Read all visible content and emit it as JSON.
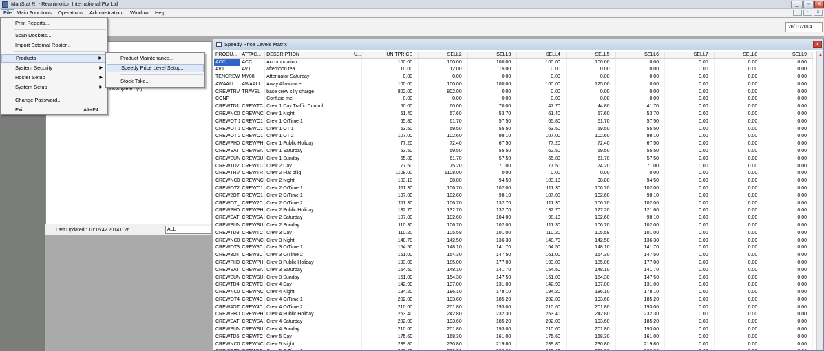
{
  "app": {
    "title": "ManStat RI - Reanimotion International Pty Ltd",
    "window_buttons": {
      "minimize": "_",
      "restore": "▫",
      "close": "✕"
    },
    "mdi_buttons": {
      "minimize": "_",
      "restore": "▫",
      "close": "x"
    }
  },
  "menubar": {
    "items": [
      "File",
      "Main Functions",
      "Operations",
      "Administration",
      "Window",
      "Help"
    ]
  },
  "toolbar": {
    "date": "26/11/2014"
  },
  "file_menu": {
    "items": [
      {
        "label": "Print Reports..."
      },
      {
        "label": "Scan Dockets..."
      },
      {
        "label": "Import External Roster..."
      },
      {
        "label": "Products",
        "arrow": "▶"
      },
      {
        "label": "System Security",
        "arrow": "▶"
      },
      {
        "label": "Roster Setup",
        "arrow": "▶"
      },
      {
        "label": "System Setup",
        "arrow": "▶"
      },
      {
        "label": "Change Password..."
      },
      {
        "label": "Exit",
        "accel": "Alt+F4"
      }
    ]
  },
  "products_submenu": {
    "items": [
      "Product Maintenance...",
      "Speedy Price Level Setup...",
      "Stock Take..."
    ]
  },
  "left_panel": {
    "incomplete_label": "Incomplete",
    "incomplete_count": "(4)",
    "last_updated": "Last Updated : 10:16:42 20141126",
    "filter_value": "ALL"
  },
  "grid_window": {
    "title": "Speedy Price Levels Matrix",
    "close": "x",
    "columns": [
      "PRODU...",
      "ATTAC...",
      "DESCRIPTION",
      "U...",
      "UNITPRICE",
      "SELL2",
      "SELL3",
      "SELL4",
      "SELL5",
      "SELL6",
      "SELL7",
      "SELL8",
      "SELL9"
    ],
    "rows": [
      [
        "ACC",
        "ACC",
        "Accomodation",
        "",
        "100.00",
        "100.00",
        "100.00",
        "100.00",
        "100.00",
        "0.00",
        "0.00",
        "0.00",
        "0.00"
      ],
      [
        "AVT",
        "AVT",
        "afternoon tea",
        "",
        "10.00",
        "12.00",
        "15.00",
        "0.00",
        "0.00",
        "0.00",
        "0.00",
        "0.00",
        "0.00"
      ],
      [
        "TENCREW",
        "MY08",
        "Attenuator Saturday",
        "",
        "0.00",
        "0.00",
        "0.00",
        "0.00",
        "0.00",
        "0.00",
        "0.00",
        "0.00",
        "0.00"
      ],
      [
        "AWAALL",
        "AWAALL",
        "Away Allowance",
        "",
        "100.00",
        "100.00",
        "100.00",
        "100.00",
        "125.00",
        "0.00",
        "0.00",
        "0.00",
        "0.00"
      ],
      [
        "CREWTRV",
        "TRAVEL",
        "base crew silly charge",
        "",
        "802.00",
        "802.00",
        "0.00",
        "0.00",
        "0.00",
        "0.00",
        "0.00",
        "0.00",
        "0.00"
      ],
      [
        "CONF",
        "",
        "Confuse me",
        "",
        "0.00",
        "0.00",
        "0.00",
        "0.00",
        "0.00",
        "0.00",
        "0.00",
        "0.00",
        "0.00"
      ],
      [
        "CREWTD1",
        "CREWTC",
        "Crew 1 Day Traffic Control",
        "",
        "50.00",
        "60.00",
        "70.00",
        "47.70",
        "44.80",
        "41.70",
        "0.00",
        "0.00",
        "0.00"
      ],
      [
        "CREWNC0",
        "CREWNC",
        "Crew 1 Night",
        "",
        "61.40",
        "57.60",
        "53.70",
        "61.40",
        "57.60",
        "53.70",
        "0.00",
        "0.00",
        "0.00"
      ],
      [
        "CREWOT 1",
        "CREWO1",
        "Crew 1 O/Time 1",
        "",
        "65.80",
        "61.70",
        "57.50",
        "65.80",
        "61.70",
        "57.50",
        "0.00",
        "0.00",
        "0.00"
      ],
      [
        "CREWOT 1",
        "CREWO1",
        "Crew 1 OT 1",
        "",
        "63.50",
        "59.50",
        "55.50",
        "63.50",
        "59.50",
        "55.50",
        "0.00",
        "0.00",
        "0.00"
      ],
      [
        "CREWOT 2",
        "CREWO1",
        "Crew 1 OT 2",
        "",
        "107.00",
        "102.60",
        "98.10",
        "107.00",
        "102.60",
        "98.10",
        "0.00",
        "0.00",
        "0.00"
      ],
      [
        "CREWPH0",
        "CREWPH",
        "Crew 1 Public Holiday",
        "",
        "77.20",
        "72.40",
        "67.50",
        "77.20",
        "72.40",
        "67.50",
        "0.00",
        "0.00",
        "0.00"
      ],
      [
        "CREWSAT",
        "CREWSA",
        "Crew 1 Saturday",
        "",
        "63.50",
        "59.50",
        "55.50",
        "62.50",
        "59.50",
        "55.50",
        "0.00",
        "0.00",
        "0.00"
      ],
      [
        "CREWSUN",
        "CREWSU",
        "Crew 1 Sunday",
        "",
        "65.80",
        "61.70",
        "57.50",
        "65.80",
        "61.70",
        "57.50",
        "0.00",
        "0.00",
        "0.00"
      ],
      [
        "CREWTD2",
        "CREWTC",
        "Crew 2 Day",
        "",
        "77.50",
        "75.20",
        "71.00",
        "77.50",
        "74.20",
        "71.00",
        "0.00",
        "0.00",
        "0.00"
      ],
      [
        "CREWTRV",
        "CREWTR",
        "Crew 2 Flat billg",
        "",
        "1108.00",
        "1108.00",
        "0.00",
        "0.00",
        "0.00",
        "0.00",
        "0.00",
        "0.00",
        "0.00"
      ],
      [
        "CREWNC0",
        "CREWNC",
        "Crew 2 Night",
        "",
        "103.10",
        "98.80",
        "94.50",
        "103.10",
        "98.80",
        "94.50",
        "0.00",
        "0.00",
        "0.00"
      ],
      [
        "CREWOT2",
        "CREWO1",
        "Crew 2 O/Time 1",
        "",
        "111.30",
        "106.70",
        "102.00",
        "111.30",
        "106.70",
        "102.00",
        "0.00",
        "0.00",
        "0.00"
      ],
      [
        "CREW2OT",
        "CREWO1",
        "Crew 2 O/Time 1",
        "",
        "107.00",
        "102.60",
        "98.10",
        "107.00",
        "102.60",
        "98.10",
        "0.00",
        "0.00",
        "0.00"
      ],
      [
        "CREWOT_",
        "CREW2C",
        "Crew 2 O/Time 2",
        "",
        "111.30",
        "106.70",
        "132.70",
        "111.30",
        "106.70",
        "102.00",
        "0.00",
        "0.00",
        "0.00"
      ],
      [
        "CREWPH0",
        "CREWPH",
        "Crew 2 Public Holiday",
        "",
        "132.70",
        "132.70",
        "132.70",
        "132.70",
        "127.20",
        "121.60",
        "0.00",
        "0.00",
        "0.00"
      ],
      [
        "CREWSAT",
        "CREWSA",
        "Crew 2 Saturday",
        "",
        "107.00",
        "102.60",
        "104.00",
        "98.10",
        "102.60",
        "98.10",
        "0.00",
        "0.00",
        "0.00"
      ],
      [
        "CREWSUN",
        "CREWSU",
        "Crew 2 Sunday",
        "",
        "110.30",
        "106.70",
        "102.00",
        "111.30",
        "106.70",
        "102.00",
        "0.00",
        "0.00",
        "0.00"
      ],
      [
        "CREWTD3",
        "CREWTC",
        "Crew 3 Day",
        "",
        "110.20",
        "105.58",
        "101.00",
        "110.20",
        "105.58",
        "101.00",
        "0.00",
        "0.00",
        "0.00"
      ],
      [
        "CREWNC0",
        "CREWNC",
        "Crew 3 Night",
        "",
        "148.70",
        "142.50",
        "136.30",
        "148.70",
        "142.50",
        "136.30",
        "0.00",
        "0.00",
        "0.00"
      ],
      [
        "CREWOT3",
        "CREW3C",
        "Crew 3 O/Time 1",
        "",
        "154.50",
        "148.10",
        "141.70",
        "154.50",
        "148.10",
        "141.70",
        "0.00",
        "0.00",
        "0.00"
      ],
      [
        "CREW3OT",
        "CREW3C",
        "Crew 3 O/Time 2",
        "",
        "161.00",
        "154.30",
        "147.50",
        "161.00",
        "154.30",
        "147.50",
        "0.00",
        "0.00",
        "0.00"
      ],
      [
        "CREWPH0",
        "CREWPH",
        "Crew 3 Public Holiday",
        "",
        "193.00",
        "185.00",
        "177.00",
        "193.00",
        "185.00",
        "177.00",
        "0.00",
        "0.00",
        "0.00"
      ],
      [
        "CREWSAT",
        "CREWSA",
        "Crew 3 Saturday",
        "",
        "154.50",
        "148.10",
        "141.70",
        "154.50",
        "148.10",
        "141.70",
        "0.00",
        "0.00",
        "0.00"
      ],
      [
        "CREWSUN",
        "CREWSU",
        "Crew 3 Sunday",
        "",
        "161.00",
        "154.30",
        "147.50",
        "161.00",
        "154.30",
        "147.50",
        "0.00",
        "0.00",
        "0.00"
      ],
      [
        "CREWTD4",
        "CREWTC",
        "Crew 4 Day",
        "",
        "142.90",
        "137.00",
        "131.00",
        "142.90",
        "137.00",
        "131.00",
        "0.00",
        "0.00",
        "0.00"
      ],
      [
        "CREWNC0",
        "CREWNC",
        "Crew 4 Night",
        "",
        "194.20",
        "186.10",
        "178.10",
        "194.20",
        "186.10",
        "178.10",
        "0.00",
        "0.00",
        "0.00"
      ],
      [
        "CREWOT4",
        "CREW4C",
        "Crew 4 O/Time 1",
        "",
        "202.00",
        "193.60",
        "185.20",
        "202.00",
        "193.60",
        "185.20",
        "0.00",
        "0.00",
        "0.00"
      ],
      [
        "CREW4OT",
        "CREW4C",
        "Crew 4 O/Time 2",
        "",
        "210.60",
        "201.80",
        "193.00",
        "210.60",
        "201.80",
        "193.00",
        "0.00",
        "0.00",
        "0.00"
      ],
      [
        "CREWPH0",
        "CREWPH",
        "Crew 4 Public Holiday",
        "",
        "253.40",
        "242.80",
        "232.30",
        "253.40",
        "242.80",
        "232.30",
        "0.00",
        "0.00",
        "0.00"
      ],
      [
        "CREWSAT",
        "CREWSA",
        "Crew 4 Saturday",
        "",
        "202.00",
        "193.60",
        "185.20",
        "202.00",
        "193.60",
        "185.20",
        "0.00",
        "0.00",
        "0.00"
      ],
      [
        "CREWSUN",
        "CREWSU",
        "Crew 4 Sunday",
        "",
        "210.60",
        "201.80",
        "193.00",
        "210.60",
        "201.80",
        "193.00",
        "0.00",
        "0.00",
        "0.00"
      ],
      [
        "CREWTD5",
        "CREWTC",
        "Crew 5 Day",
        "",
        "175.60",
        "168.30",
        "161.00",
        "175.60",
        "168.30",
        "161.00",
        "0.00",
        "0.00",
        "0.00"
      ],
      [
        "CREWNC0",
        "CREWNC",
        "Crew 5 Night",
        "",
        "239.80",
        "230.80",
        "219.80",
        "239.80",
        "230.80",
        "219.80",
        "0.00",
        "0.00",
        "0.00"
      ],
      [
        "CREWOT5",
        "CREW5C",
        "Crew 5 O/Time 1",
        "",
        "249.60",
        "239.20",
        "228.80",
        "249.60",
        "239.20",
        "228.80",
        "0.00",
        "0.00",
        "0.00"
      ]
    ],
    "selected_row": 0
  },
  "colors": {
    "selection": "#3166c6",
    "menu_highlight": "#dfe8f6"
  }
}
